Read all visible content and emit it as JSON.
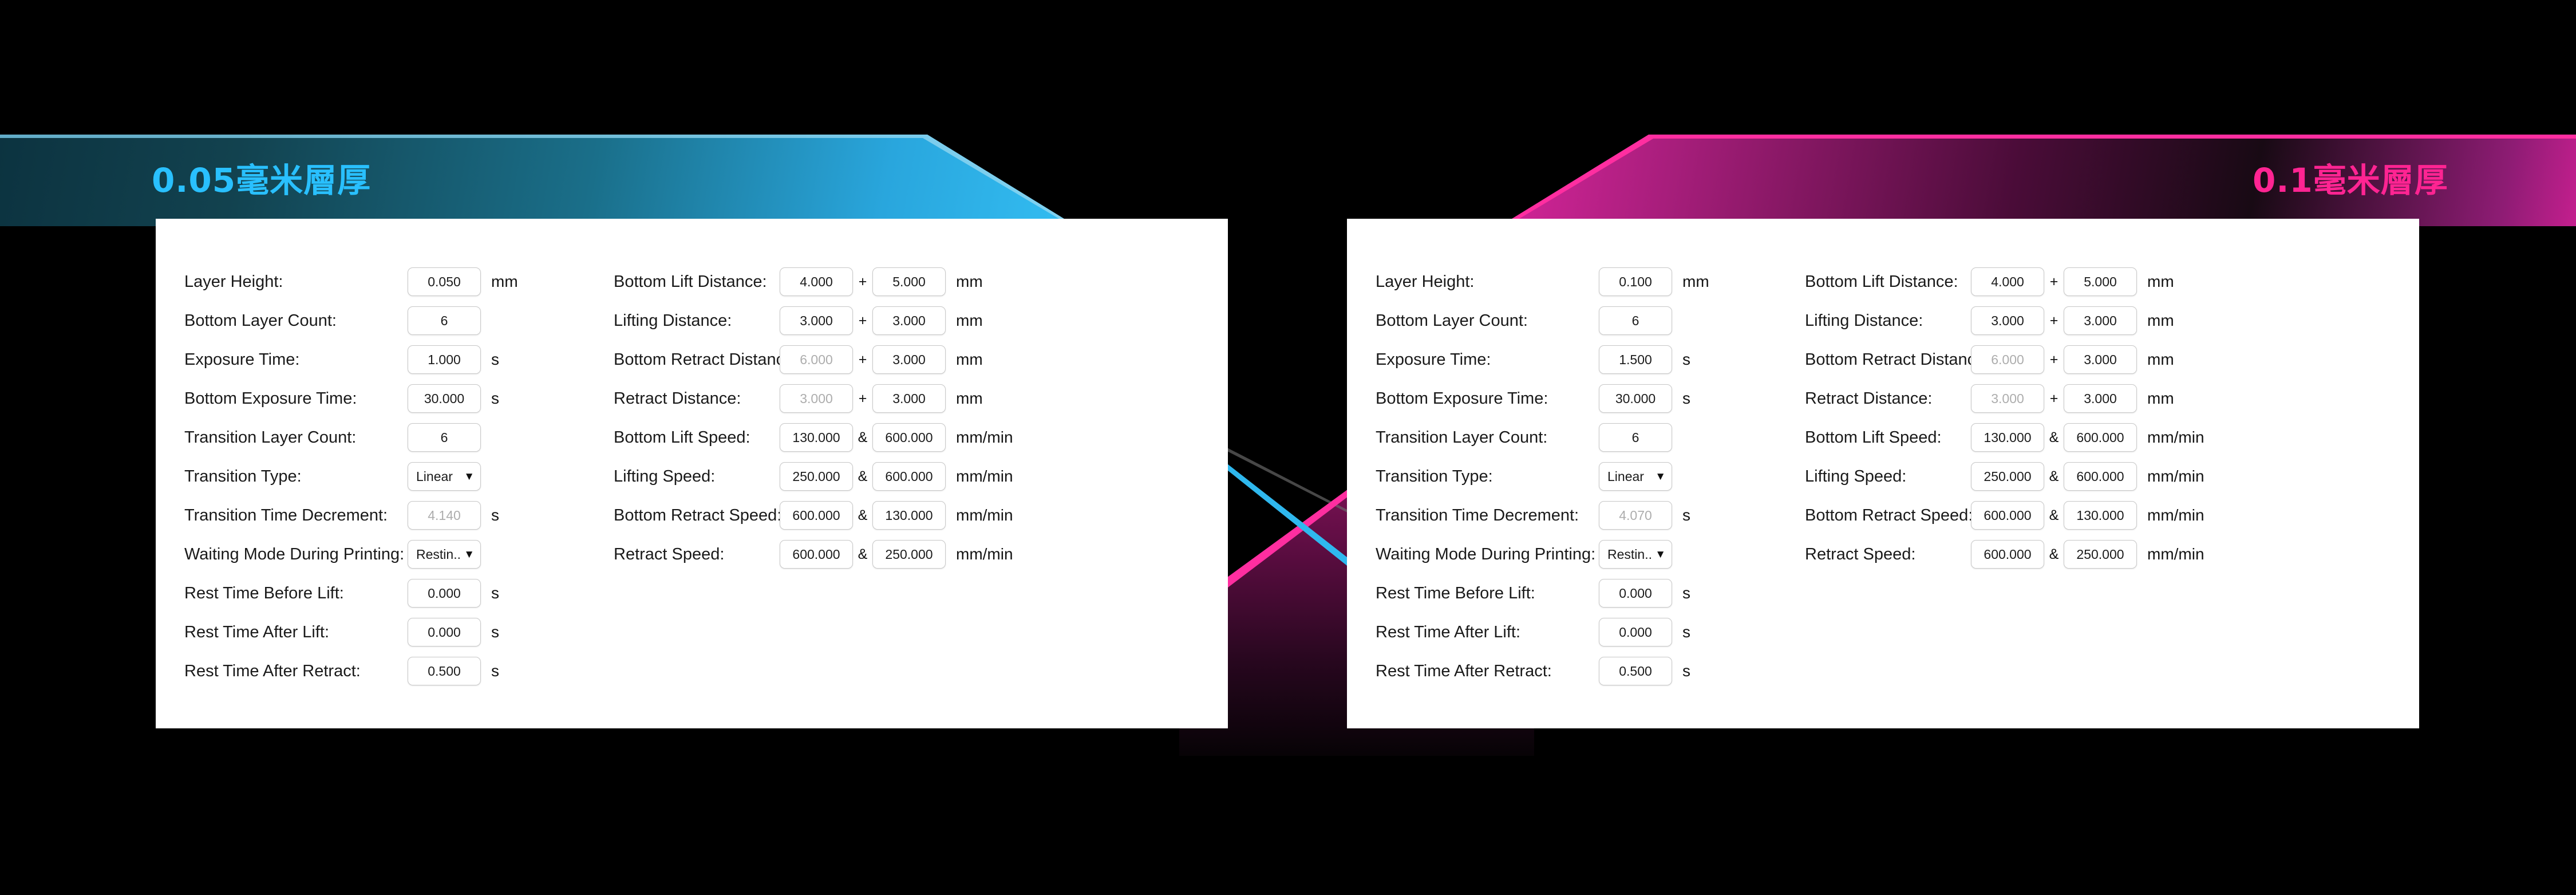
{
  "banners": {
    "left": {
      "title": "0.05毫米層厚",
      "color": "#29c0ff"
    },
    "right": {
      "title": "0.1毫米層厚",
      "color": "#ff2492"
    }
  },
  "operators": {
    "plus": "+",
    "amp": "&"
  },
  "units": {
    "mm": "mm",
    "s": "s",
    "mm_min": "mm/min"
  },
  "panels": [
    {
      "id": "layer-0-05",
      "title": "0.05毫米層厚",
      "left_column": [
        {
          "label": "Layer Height:",
          "value": "0.050",
          "unit": "mm",
          "type": "number",
          "dim": false
        },
        {
          "label": "Bottom Layer Count:",
          "value": "6",
          "unit": "",
          "type": "number",
          "dim": false
        },
        {
          "label": "Exposure Time:",
          "value": "1.000",
          "unit": "s",
          "type": "number",
          "dim": false
        },
        {
          "label": "Bottom Exposure Time:",
          "value": "30.000",
          "unit": "s",
          "type": "number",
          "dim": false
        },
        {
          "label": "Transition Layer Count:",
          "value": "6",
          "unit": "",
          "type": "number",
          "dim": false
        },
        {
          "label": "Transition Type:",
          "value": "Linear",
          "unit": "",
          "type": "select",
          "dim": false
        },
        {
          "label": "Transition Time Decrement:",
          "value": "4.140",
          "unit": "s",
          "type": "number",
          "dim": true
        },
        {
          "label": "Waiting Mode During Printing:",
          "value": "Restin...",
          "unit": "",
          "type": "select",
          "dim": false
        },
        {
          "label": "Rest Time Before Lift:",
          "value": "0.000",
          "unit": "s",
          "type": "number",
          "dim": false
        },
        {
          "label": "Rest Time After Lift:",
          "value": "0.000",
          "unit": "s",
          "type": "number",
          "dim": false
        },
        {
          "label": "Rest Time After Retract:",
          "value": "0.500",
          "unit": "s",
          "type": "number",
          "dim": false
        }
      ],
      "right_column": [
        {
          "label": "Bottom Lift Distance:",
          "v1": "4.000",
          "v2": "5.000",
          "op": "+",
          "unit": "mm",
          "dim1": false,
          "dim2": false
        },
        {
          "label": "Lifting Distance:",
          "v1": "3.000",
          "v2": "3.000",
          "op": "+",
          "unit": "mm",
          "dim1": false,
          "dim2": false
        },
        {
          "label": "Bottom Retract Distance:",
          "v1": "6.000",
          "v2": "3.000",
          "op": "+",
          "unit": "mm",
          "dim1": true,
          "dim2": false
        },
        {
          "label": "Retract Distance:",
          "v1": "3.000",
          "v2": "3.000",
          "op": "+",
          "unit": "mm",
          "dim1": true,
          "dim2": false
        },
        {
          "label": "Bottom Lift Speed:",
          "v1": "130.000",
          "v2": "600.000",
          "op": "&",
          "unit": "mm/min",
          "dim1": false,
          "dim2": false
        },
        {
          "label": "Lifting Speed:",
          "v1": "250.000",
          "v2": "600.000",
          "op": "&",
          "unit": "mm/min",
          "dim1": false,
          "dim2": false
        },
        {
          "label": "Bottom Retract Speed:",
          "v1": "600.000",
          "v2": "130.000",
          "op": "&",
          "unit": "mm/min",
          "dim1": false,
          "dim2": false
        },
        {
          "label": "Retract Speed:",
          "v1": "600.000",
          "v2": "250.000",
          "op": "&",
          "unit": "mm/min",
          "dim1": false,
          "dim2": false
        }
      ]
    },
    {
      "id": "layer-0-1",
      "title": "0.1毫米層厚",
      "left_column": [
        {
          "label": "Layer Height:",
          "value": "0.100",
          "unit": "mm",
          "type": "number",
          "dim": false
        },
        {
          "label": "Bottom Layer Count:",
          "value": "6",
          "unit": "",
          "type": "number",
          "dim": false
        },
        {
          "label": "Exposure Time:",
          "value": "1.500",
          "unit": "s",
          "type": "number",
          "dim": false
        },
        {
          "label": "Bottom Exposure Time:",
          "value": "30.000",
          "unit": "s",
          "type": "number",
          "dim": false
        },
        {
          "label": "Transition Layer Count:",
          "value": "6",
          "unit": "",
          "type": "number",
          "dim": false
        },
        {
          "label": "Transition Type:",
          "value": "Linear",
          "unit": "",
          "type": "select",
          "dim": false
        },
        {
          "label": "Transition Time Decrement:",
          "value": "4.070",
          "unit": "s",
          "type": "number",
          "dim": true
        },
        {
          "label": "Waiting Mode During Printing:",
          "value": "Restin...",
          "unit": "",
          "type": "select",
          "dim": false
        },
        {
          "label": "Rest Time Before Lift:",
          "value": "0.000",
          "unit": "s",
          "type": "number",
          "dim": false
        },
        {
          "label": "Rest Time After Lift:",
          "value": "0.000",
          "unit": "s",
          "type": "number",
          "dim": false
        },
        {
          "label": "Rest Time After Retract:",
          "value": "0.500",
          "unit": "s",
          "type": "number",
          "dim": false
        }
      ],
      "right_column": [
        {
          "label": "Bottom Lift Distance:",
          "v1": "4.000",
          "v2": "5.000",
          "op": "+",
          "unit": "mm",
          "dim1": false,
          "dim2": false
        },
        {
          "label": "Lifting Distance:",
          "v1": "3.000",
          "v2": "3.000",
          "op": "+",
          "unit": "mm",
          "dim1": false,
          "dim2": false
        },
        {
          "label": "Bottom Retract Distance:",
          "v1": "6.000",
          "v2": "3.000",
          "op": "+",
          "unit": "mm",
          "dim1": true,
          "dim2": false
        },
        {
          "label": "Retract Distance:",
          "v1": "3.000",
          "v2": "3.000",
          "op": "+",
          "unit": "mm",
          "dim1": true,
          "dim2": false
        },
        {
          "label": "Bottom Lift Speed:",
          "v1": "130.000",
          "v2": "600.000",
          "op": "&",
          "unit": "mm/min",
          "dim1": false,
          "dim2": false
        },
        {
          "label": "Lifting Speed:",
          "v1": "250.000",
          "v2": "600.000",
          "op": "&",
          "unit": "mm/min",
          "dim1": false,
          "dim2": false
        },
        {
          "label": "Bottom Retract Speed:",
          "v1": "600.000",
          "v2": "130.000",
          "op": "&",
          "unit": "mm/min",
          "dim1": false,
          "dim2": false
        },
        {
          "label": "Retract Speed:",
          "v1": "600.000",
          "v2": "250.000",
          "op": "&",
          "unit": "mm/min",
          "dim1": false,
          "dim2": false
        }
      ]
    }
  ],
  "icons": {
    "caret_down": "▼"
  }
}
